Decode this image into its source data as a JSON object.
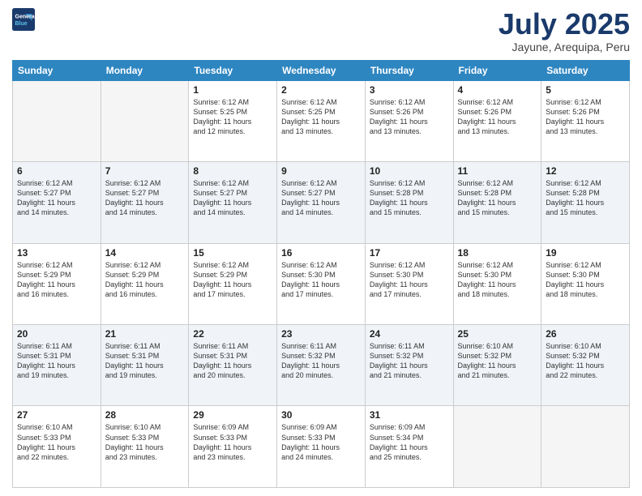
{
  "header": {
    "logo_line1": "General",
    "logo_line2": "Blue",
    "month": "July 2025",
    "location": "Jayune, Arequipa, Peru"
  },
  "weekdays": [
    "Sunday",
    "Monday",
    "Tuesday",
    "Wednesday",
    "Thursday",
    "Friday",
    "Saturday"
  ],
  "weeks": [
    [
      {
        "day": "",
        "info": ""
      },
      {
        "day": "",
        "info": ""
      },
      {
        "day": "1",
        "info": "Sunrise: 6:12 AM\nSunset: 5:25 PM\nDaylight: 11 hours\nand 12 minutes."
      },
      {
        "day": "2",
        "info": "Sunrise: 6:12 AM\nSunset: 5:25 PM\nDaylight: 11 hours\nand 13 minutes."
      },
      {
        "day": "3",
        "info": "Sunrise: 6:12 AM\nSunset: 5:26 PM\nDaylight: 11 hours\nand 13 minutes."
      },
      {
        "day": "4",
        "info": "Sunrise: 6:12 AM\nSunset: 5:26 PM\nDaylight: 11 hours\nand 13 minutes."
      },
      {
        "day": "5",
        "info": "Sunrise: 6:12 AM\nSunset: 5:26 PM\nDaylight: 11 hours\nand 13 minutes."
      }
    ],
    [
      {
        "day": "6",
        "info": "Sunrise: 6:12 AM\nSunset: 5:27 PM\nDaylight: 11 hours\nand 14 minutes."
      },
      {
        "day": "7",
        "info": "Sunrise: 6:12 AM\nSunset: 5:27 PM\nDaylight: 11 hours\nand 14 minutes."
      },
      {
        "day": "8",
        "info": "Sunrise: 6:12 AM\nSunset: 5:27 PM\nDaylight: 11 hours\nand 14 minutes."
      },
      {
        "day": "9",
        "info": "Sunrise: 6:12 AM\nSunset: 5:27 PM\nDaylight: 11 hours\nand 14 minutes."
      },
      {
        "day": "10",
        "info": "Sunrise: 6:12 AM\nSunset: 5:28 PM\nDaylight: 11 hours\nand 15 minutes."
      },
      {
        "day": "11",
        "info": "Sunrise: 6:12 AM\nSunset: 5:28 PM\nDaylight: 11 hours\nand 15 minutes."
      },
      {
        "day": "12",
        "info": "Sunrise: 6:12 AM\nSunset: 5:28 PM\nDaylight: 11 hours\nand 15 minutes."
      }
    ],
    [
      {
        "day": "13",
        "info": "Sunrise: 6:12 AM\nSunset: 5:29 PM\nDaylight: 11 hours\nand 16 minutes."
      },
      {
        "day": "14",
        "info": "Sunrise: 6:12 AM\nSunset: 5:29 PM\nDaylight: 11 hours\nand 16 minutes."
      },
      {
        "day": "15",
        "info": "Sunrise: 6:12 AM\nSunset: 5:29 PM\nDaylight: 11 hours\nand 17 minutes."
      },
      {
        "day": "16",
        "info": "Sunrise: 6:12 AM\nSunset: 5:30 PM\nDaylight: 11 hours\nand 17 minutes."
      },
      {
        "day": "17",
        "info": "Sunrise: 6:12 AM\nSunset: 5:30 PM\nDaylight: 11 hours\nand 17 minutes."
      },
      {
        "day": "18",
        "info": "Sunrise: 6:12 AM\nSunset: 5:30 PM\nDaylight: 11 hours\nand 18 minutes."
      },
      {
        "day": "19",
        "info": "Sunrise: 6:12 AM\nSunset: 5:30 PM\nDaylight: 11 hours\nand 18 minutes."
      }
    ],
    [
      {
        "day": "20",
        "info": "Sunrise: 6:11 AM\nSunset: 5:31 PM\nDaylight: 11 hours\nand 19 minutes."
      },
      {
        "day": "21",
        "info": "Sunrise: 6:11 AM\nSunset: 5:31 PM\nDaylight: 11 hours\nand 19 minutes."
      },
      {
        "day": "22",
        "info": "Sunrise: 6:11 AM\nSunset: 5:31 PM\nDaylight: 11 hours\nand 20 minutes."
      },
      {
        "day": "23",
        "info": "Sunrise: 6:11 AM\nSunset: 5:32 PM\nDaylight: 11 hours\nand 20 minutes."
      },
      {
        "day": "24",
        "info": "Sunrise: 6:11 AM\nSunset: 5:32 PM\nDaylight: 11 hours\nand 21 minutes."
      },
      {
        "day": "25",
        "info": "Sunrise: 6:10 AM\nSunset: 5:32 PM\nDaylight: 11 hours\nand 21 minutes."
      },
      {
        "day": "26",
        "info": "Sunrise: 6:10 AM\nSunset: 5:32 PM\nDaylight: 11 hours\nand 22 minutes."
      }
    ],
    [
      {
        "day": "27",
        "info": "Sunrise: 6:10 AM\nSunset: 5:33 PM\nDaylight: 11 hours\nand 22 minutes."
      },
      {
        "day": "28",
        "info": "Sunrise: 6:10 AM\nSunset: 5:33 PM\nDaylight: 11 hours\nand 23 minutes."
      },
      {
        "day": "29",
        "info": "Sunrise: 6:09 AM\nSunset: 5:33 PM\nDaylight: 11 hours\nand 23 minutes."
      },
      {
        "day": "30",
        "info": "Sunrise: 6:09 AM\nSunset: 5:33 PM\nDaylight: 11 hours\nand 24 minutes."
      },
      {
        "day": "31",
        "info": "Sunrise: 6:09 AM\nSunset: 5:34 PM\nDaylight: 11 hours\nand 25 minutes."
      },
      {
        "day": "",
        "info": ""
      },
      {
        "day": "",
        "info": ""
      }
    ]
  ]
}
